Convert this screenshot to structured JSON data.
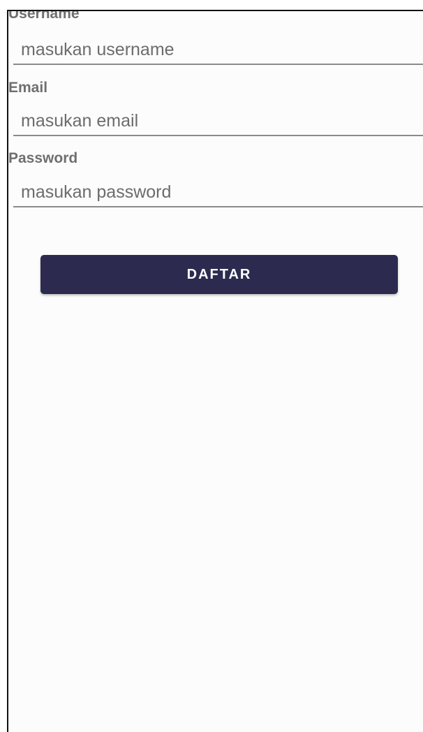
{
  "form": {
    "username": {
      "label": "Username",
      "placeholder": "masukan username",
      "value": ""
    },
    "email": {
      "label": "Email",
      "placeholder": "masukan email",
      "value": ""
    },
    "password": {
      "label": "Password",
      "placeholder": "masukan password",
      "value": ""
    },
    "submit_label": "DAFTAR"
  },
  "colors": {
    "button_background": "#2c2b4f",
    "button_text": "#ffffff",
    "label_text": "#6f6f6f",
    "input_underline": "#8a8a8a"
  }
}
